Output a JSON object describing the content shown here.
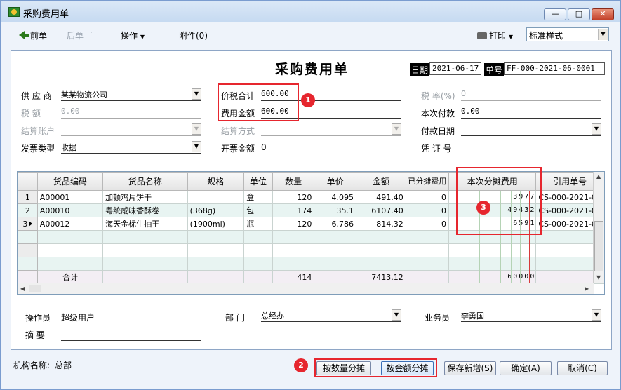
{
  "window": {
    "title": "采购费用单",
    "minimize": "▭",
    "maximize": "□",
    "close": "✕"
  },
  "toolbar": {
    "prev": "前单",
    "next": "后单",
    "operate": "操作",
    "attach": "附件(0)",
    "print": "打印",
    "template": "标准样式"
  },
  "form": {
    "title": "采购费用单",
    "date_label": "日期",
    "date_value": "2021-06-17",
    "no_label": "单号",
    "no_value": "FF-000-2021-06-0001",
    "supplier_label": "供 应 商",
    "supplier_value": "某某物流公司",
    "tax_amount_label": "税    额",
    "tax_amount_value": "0.00",
    "settle_account_label": "结算账户",
    "invoice_type_label": "发票类型",
    "invoice_type_value": "收据",
    "total_with_tax_label": "价税合计",
    "total_with_tax_value": "600.00",
    "fee_amount_label": "费用金额",
    "fee_amount_value": "600.00",
    "settle_method_label": "结算方式",
    "invoice_amount_label": "开票金额",
    "invoice_amount_value": "0",
    "tax_rate_label": "税 率(%)",
    "tax_rate_value": "0",
    "pay_now_label": "本次付款",
    "pay_now_value": "0.00",
    "pay_date_label": "付款日期",
    "voucher_label": "凭 证 号",
    "operator_label": "操作员",
    "operator_value": "超级用户",
    "department_label": "部  门",
    "department_value": "总经办",
    "salesman_label": "业务员",
    "salesman_value": "李勇国",
    "summary_label": "摘  要"
  },
  "markers": [
    "1",
    "2",
    "3"
  ],
  "grid": {
    "columns": [
      "货品编码",
      "货品名称",
      "规格",
      "单位",
      "数量",
      "单价",
      "金额",
      "已分摊费用",
      "本次分摊费用",
      "引用单号"
    ],
    "rows": [
      {
        "no": "1",
        "code": "A00001",
        "name": "加顿鸡片饼干",
        "spec": "",
        "unit": "盒",
        "qty": "120",
        "price": "4.095",
        "amount": "491.40",
        "allocated": "0",
        "alloc_now": "3977",
        "ref": "CS-000-2021-06"
      },
      {
        "no": "2",
        "code": "A00010",
        "name": "粤统咸味香酥卷",
        "spec": "(368g)",
        "unit": "包",
        "qty": "174",
        "price": "35.1",
        "amount": "6107.40",
        "allocated": "0",
        "alloc_now": "49432",
        "ref": "CS-000-2021-06"
      },
      {
        "no": "3",
        "code": "A00012",
        "name": "海天金标生抽王",
        "spec": "(1900ml)",
        "unit": "瓶",
        "qty": "120",
        "price": "6.786",
        "amount": "814.32",
        "allocated": "0",
        "alloc_now": "6591",
        "ref": "CS-000-2021-06"
      }
    ],
    "total_label": "合计",
    "total_qty": "414",
    "total_amount": "7413.12",
    "total_alloc": "60000"
  },
  "footer": {
    "org_label": "机构名称:",
    "org_value": "总部",
    "btn_by_qty": "按数量分摊",
    "btn_by_amount": "按金额分摊",
    "btn_save_new": "保存新增(S)",
    "btn_ok": "确定(A)",
    "btn_cancel": "取消(C)"
  },
  "colors": {
    "highlight": "#e6262e",
    "grid_alt_row": "#e8f4f2"
  }
}
